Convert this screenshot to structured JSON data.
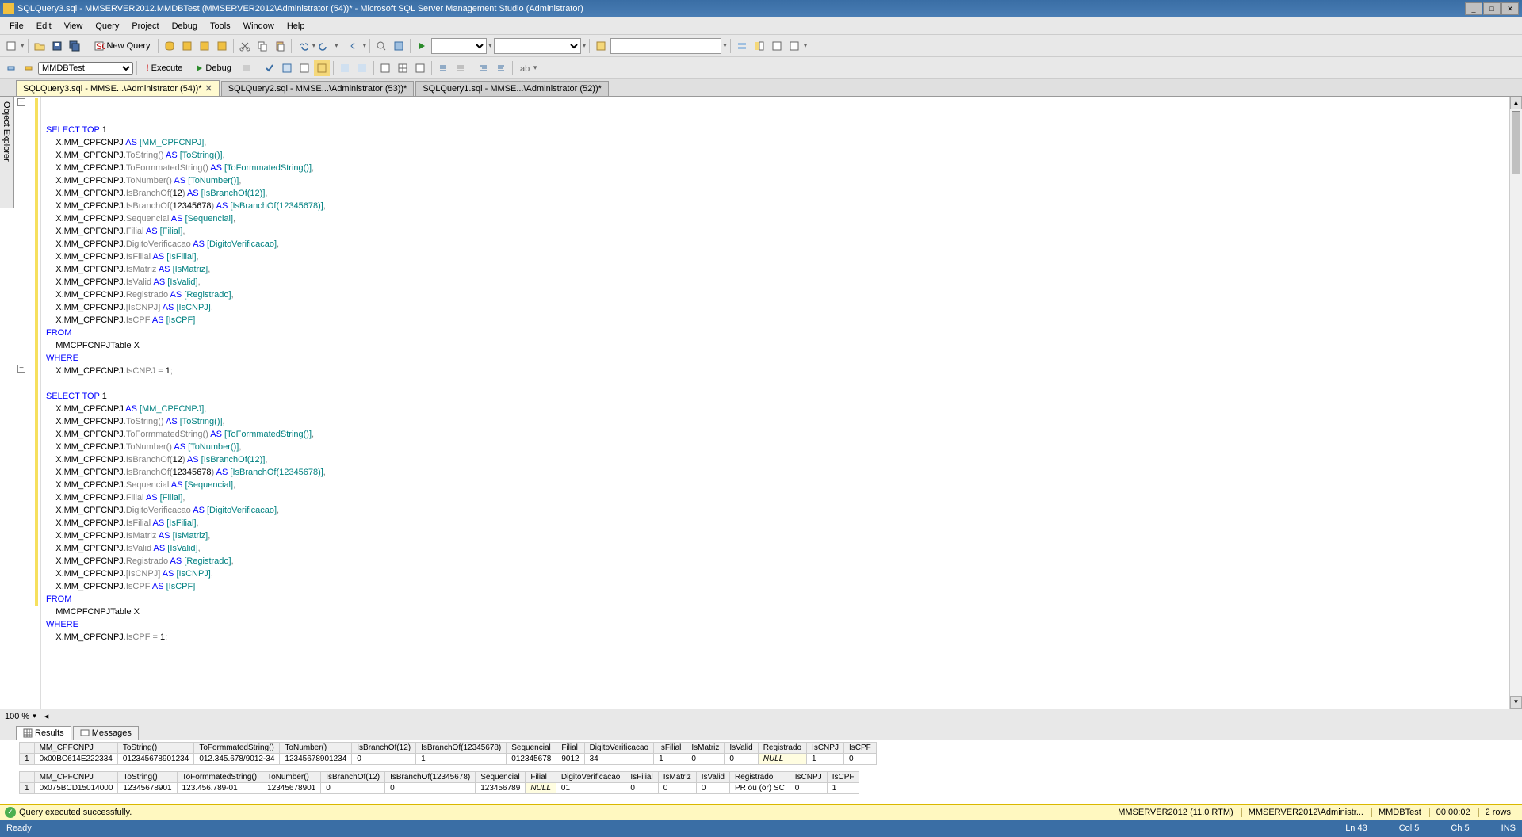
{
  "title": "SQLQuery3.sql - MMSERVER2012.MMDBTest (MMSERVER2012\\Administrator (54))* - Microsoft SQL Server Management Studio (Administrator)",
  "menus": [
    "File",
    "Edit",
    "View",
    "Query",
    "Project",
    "Debug",
    "Tools",
    "Window",
    "Help"
  ],
  "newQueryLabel": "New Query",
  "dbSelect": "MMDBTest",
  "executeLabel": "Execute",
  "debugLabel": "Debug",
  "sideTab": "Object Explorer",
  "tabs": [
    {
      "label": "SQLQuery3.sql - MMSE...\\Administrator (54))*",
      "active": true
    },
    {
      "label": "SQLQuery2.sql - MMSE...\\Administrator (53))*",
      "active": false
    },
    {
      "label": "SQLQuery1.sql - MMSE...\\Administrator (52))*",
      "active": false
    }
  ],
  "zoom": "100 %",
  "resultsTab": "Results",
  "messagesTab": "Messages",
  "grid1": {
    "headers": [
      "",
      "MM_CPFCNPJ",
      "ToString()",
      "ToFormmatedString()",
      "ToNumber()",
      "IsBranchOf(12)",
      "IsBranchOf(12345678)",
      "Sequencial",
      "Filial",
      "DigitoVerificacao",
      "IsFilial",
      "IsMatriz",
      "IsValid",
      "Registrado",
      "IsCNPJ",
      "IsCPF"
    ],
    "row": [
      "1",
      "0x00BC614E222334",
      "012345678901234",
      "012.345.678/9012-34",
      "12345678901234",
      "0",
      "1",
      "012345678",
      "9012",
      "34",
      "1",
      "0",
      "0",
      "NULL",
      "1",
      "0"
    ]
  },
  "grid2": {
    "headers": [
      "",
      "MM_CPFCNPJ",
      "ToString()",
      "ToFormmatedString()",
      "ToNumber()",
      "IsBranchOf(12)",
      "IsBranchOf(12345678)",
      "Sequencial",
      "Filial",
      "DigitoVerificacao",
      "IsFilial",
      "IsMatriz",
      "IsValid",
      "Registrado",
      "IsCNPJ",
      "IsCPF"
    ],
    "row": [
      "1",
      "0x075BCD15014000",
      "12345678901",
      "123.456.789-01",
      "12345678901",
      "0",
      "0",
      "123456789",
      "NULL",
      "01",
      "0",
      "0",
      "0",
      "PR ou (or) SC",
      "0",
      "1"
    ]
  },
  "statusYellow": {
    "msg": "Query executed successfully.",
    "server": "MMSERVER2012 (11.0 RTM)",
    "user": "MMSERVER2012\\Administr...",
    "db": "MMDBTest",
    "time": "00:00:02",
    "rows": "2 rows"
  },
  "statusBlue": {
    "ready": "Ready",
    "ln": "Ln 43",
    "col": "Col 5",
    "ch": "Ch 5",
    "ins": "INS"
  },
  "sql": {
    "l1a": "SELECT",
    "l1b": " TOP ",
    "l1c": "1",
    "l2a": "X",
    "l2b": ".",
    "l2c": "MM_CPFCNPJ",
    "l2d": " AS ",
    "l2e": "[MM_CPFCNPJ]",
    "l2f": ",",
    "l3c": "MM_CPFCNPJ",
    "l3m": ".ToString() ",
    "l3d": "AS",
    "l3e": " [ToString()]",
    "l3f": ",",
    "l4m": ".ToFormmatedString() ",
    "l4e": " [ToFormmatedString()]",
    "l5m": ".ToNumber() ",
    "l5e": " [ToNumber()]",
    "l6m": ".IsBranchOf(",
    "l6n": "12",
    "l6m2": ") ",
    "l6e": " [IsBranchOf(12)]",
    "l7n": "12345678",
    "l7e": " [IsBranchOf(12345678)]",
    "l8m": ".Sequencial ",
    "l8e": " [Sequencial]",
    "l9m": ".Filial ",
    "l9e": " [Filial]",
    "l10m": ".DigitoVerificacao ",
    "l10e": " [DigitoVerificacao]",
    "l11m": ".IsFilial ",
    "l11e": " [IsFilial]",
    "l12m": ".IsMatriz ",
    "l12e": " [IsMatriz]",
    "l13m": ".IsValid ",
    "l13e": " [IsValid]",
    "l14m": ".Registrado ",
    "l14e": " [Registrado]",
    "l15m": ".[IsCNPJ] ",
    "l15e": " [IsCNPJ]",
    "l16m": ".IsCPF ",
    "l16e": " [IsCPF]",
    "from": "FROM",
    "table": "MMCPFCNPJTable X",
    "where": "WHERE",
    "w1": "X",
    "w1b": ".",
    "w1c": "MM_CPFCNPJ",
    "w1d": ".IsCNPJ ",
    "w1e": "=",
    "w1f": " 1",
    "w1g": ";",
    "w2d": ".IsCPF ",
    "w2f": " 1"
  }
}
